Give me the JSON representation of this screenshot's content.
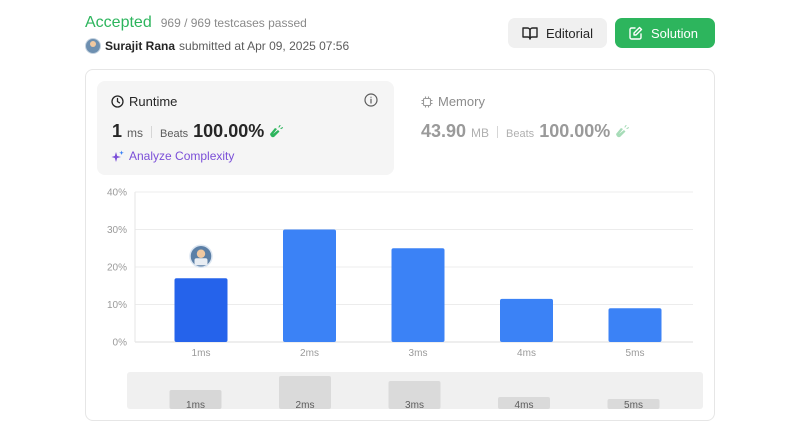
{
  "header": {
    "status": "Accepted",
    "testcases": "969 / 969 testcases passed",
    "author": "Surajit Rana",
    "submitted": "submitted at Apr 09, 2025 07:56"
  },
  "buttons": {
    "editorial": "Editorial",
    "solution": "Solution"
  },
  "runtime": {
    "title": "Runtime",
    "value": "1",
    "unit": "ms",
    "beats_label": "Beats",
    "beats": "100.00%",
    "analyze": "Analyze Complexity"
  },
  "memory": {
    "title": "Memory",
    "value": "43.90",
    "unit": "MB",
    "beats_label": "Beats",
    "beats": "100.00%"
  },
  "colors": {
    "accepted": "#2db55d",
    "bar": "#3b82f6",
    "bar_selected": "#2563eb",
    "analyze": "#7b4fd8"
  },
  "chart_data": {
    "type": "bar",
    "categories": [
      "1ms",
      "2ms",
      "3ms",
      "4ms",
      "5ms"
    ],
    "values": [
      17,
      30,
      25,
      11.5,
      9
    ],
    "yticks": [
      "0%",
      "10%",
      "20%",
      "30%",
      "40%"
    ],
    "ylim": [
      0,
      40
    ],
    "selected_index": 0,
    "grid": true,
    "overview_categories": [
      "1ms",
      "2ms",
      "3ms",
      "4ms",
      "5ms"
    ]
  }
}
